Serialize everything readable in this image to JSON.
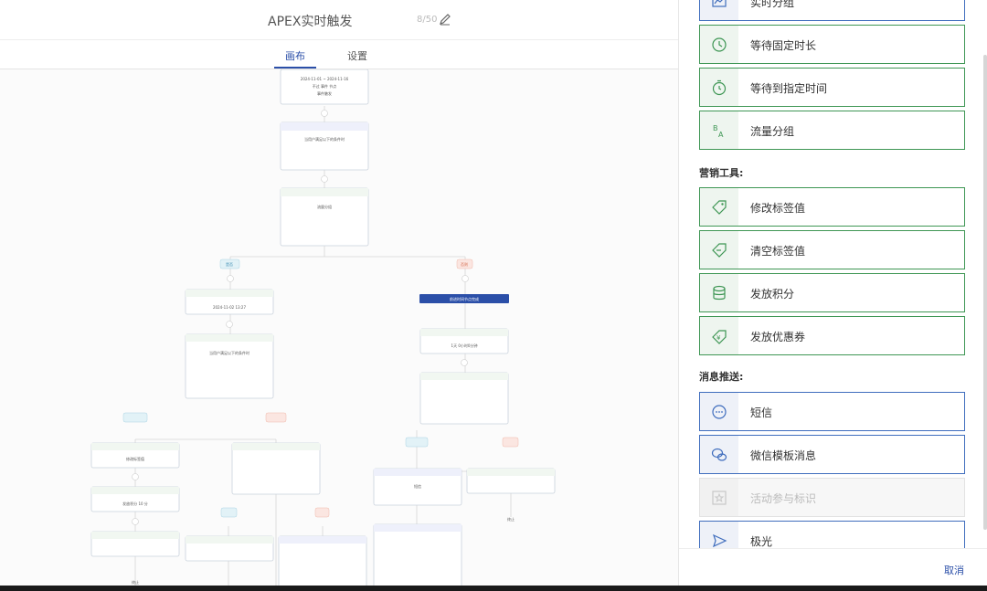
{
  "header": {
    "title": "APEX实时触发",
    "counter": "8/50"
  },
  "tabs": [
    {
      "label": "画布"
    },
    {
      "label": "设置"
    }
  ],
  "canvas": {
    "start_node": {
      "line1": "2024-11-01 ~ 2024-11-16",
      "line2": "不过 事件 节点",
      "line3": "事件触发"
    },
    "branch_yes": "是否",
    "branch_no": "否则",
    "branch_time": "2024-11-02 13:27",
    "submit_btn": "前进时间节点完成",
    "end_label": "终止",
    "card_lines": {
      "condition": "当用户满足以下的条件时",
      "flow": "流量分组",
      "wait": "1天 0小时0分钟",
      "sms": "短信",
      "tag_edit": "修改标签值",
      "points": "发放积分 10 分"
    }
  },
  "panel": {
    "top_items": [
      {
        "label": "实时分组",
        "icon": "chart-icon"
      },
      {
        "label": "等待固定时长",
        "icon": "clock-icon"
      },
      {
        "label": "等待到指定时间",
        "icon": "stopwatch-icon"
      },
      {
        "label": "流量分组",
        "icon": "split-icon"
      }
    ],
    "marketing_title": "营销工具:",
    "marketing_items": [
      {
        "label": "修改标签值",
        "icon": "tag-edit-icon"
      },
      {
        "label": "清空标签值",
        "icon": "tag-clear-icon"
      },
      {
        "label": "发放积分",
        "icon": "coins-icon"
      },
      {
        "label": "发放优惠券",
        "icon": "coupon-icon"
      }
    ],
    "message_title": "消息推送:",
    "message_items": [
      {
        "label": "短信",
        "icon": "chat-icon"
      },
      {
        "label": "微信模板消息",
        "icon": "wechat-icon"
      },
      {
        "label": "活动参与标识",
        "icon": "star-icon",
        "disabled": true
      },
      {
        "label": "极光",
        "icon": "send-icon"
      }
    ],
    "cancel_label": "取消"
  },
  "colors": {
    "green_border": "#3e9654",
    "blue_border": "#3f6dbd",
    "accent": "#2b4fa8"
  }
}
